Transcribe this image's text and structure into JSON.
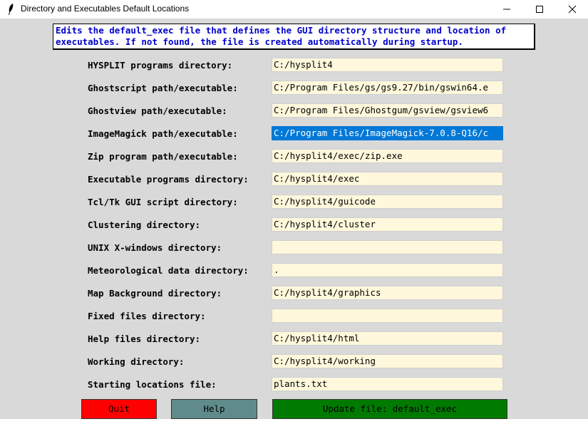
{
  "window": {
    "title": "Directory and Executables Default Locations"
  },
  "info": {
    "line1": "Edits the default_exec file that defines the GUI directory structure and location of",
    "line2": "executables. If not found, the file is created automatically during startup."
  },
  "rows": [
    {
      "label": "HYSPLIT programs directory:",
      "value": "C:/hysplit4"
    },
    {
      "label": "Ghostscript path/executable:",
      "value": "C:/Program Files/gs/gs9.27/bin/gswin64.e"
    },
    {
      "label": "Ghostview path/executable:",
      "value": "C:/Program Files/Ghostgum/gsview/gsview6"
    },
    {
      "label": "ImageMagick path/executable:",
      "value": "C:/Program Files/ImageMagick-7.0.8-Q16/c"
    },
    {
      "label": "Zip program path/executable:",
      "value": "C:/hysplit4/exec/zip.exe"
    },
    {
      "label": "Executable programs directory:",
      "value": "C:/hysplit4/exec"
    },
    {
      "label": "Tcl/Tk GUI script directory:",
      "value": "C:/hysplit4/guicode"
    },
    {
      "label": "Clustering directory:",
      "value": "C:/hysplit4/cluster"
    },
    {
      "label": "UNIX X-windows directory:",
      "value": ""
    },
    {
      "label": "Meteorological data directory:",
      "value": "."
    },
    {
      "label": "Map Background directory:",
      "value": "C:/hysplit4/graphics"
    },
    {
      "label": "Fixed files directory:",
      "value": ""
    },
    {
      "label": "Help files directory:",
      "value": "C:/hysplit4/html"
    },
    {
      "label": "Working directory:",
      "value": "C:/hysplit4/working"
    },
    {
      "label": "Starting locations file:",
      "value": "plants.txt"
    }
  ],
  "buttons": {
    "quit": "Quit",
    "help": "Help",
    "update": "Update file: default_exec"
  },
  "colors": {
    "entry_bg": "#fff8dc",
    "selection": "#0078d7",
    "quit": "#ff0000",
    "help": "#5f8b8b",
    "update": "#007a00",
    "info_text": "#0000cc"
  }
}
